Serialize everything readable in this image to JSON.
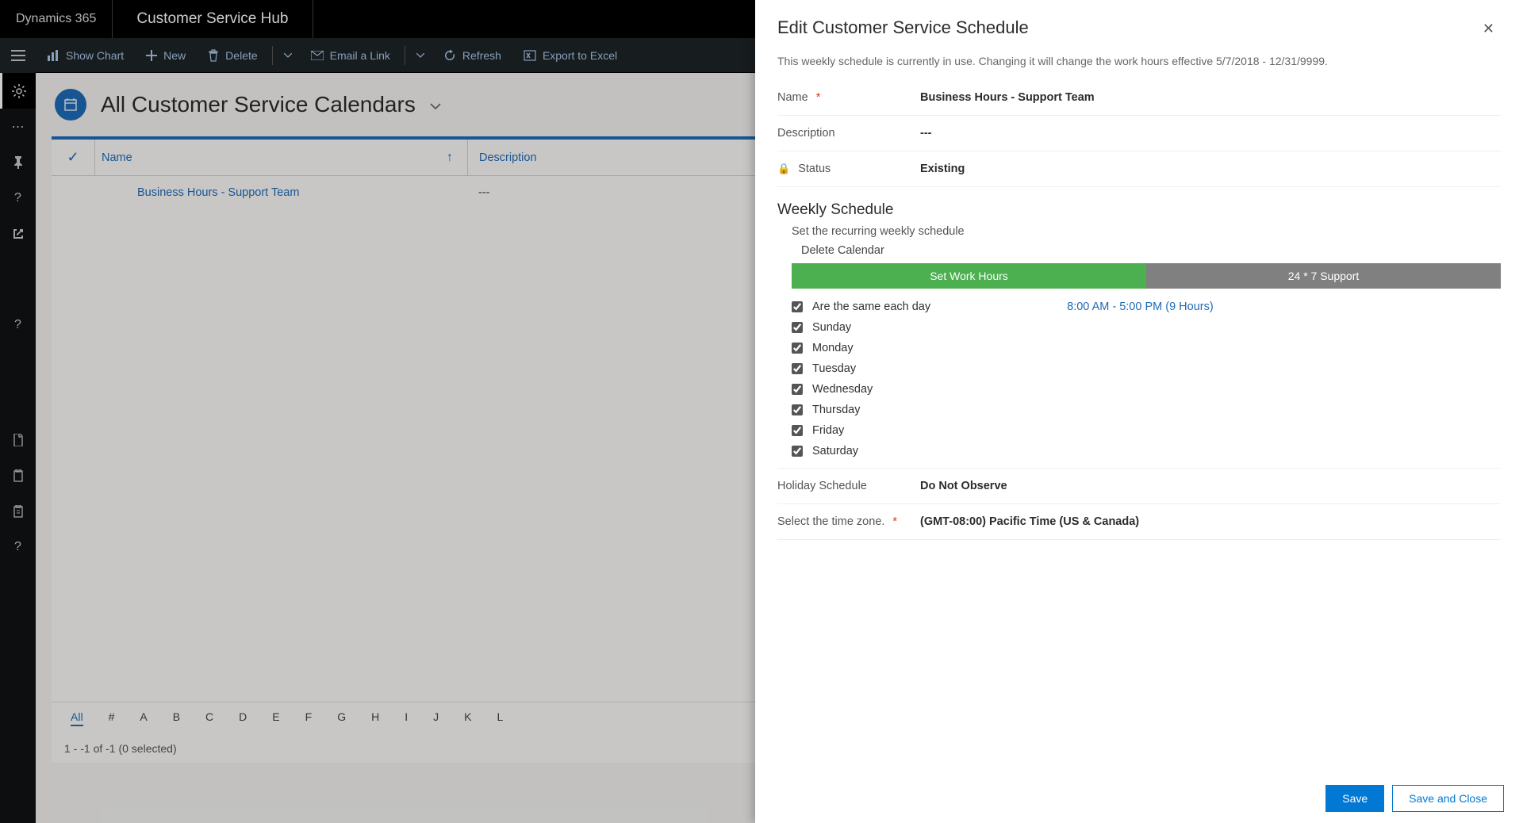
{
  "topnav": {
    "brand": "Dynamics 365",
    "app": "Customer Service Hub"
  },
  "commandbar": {
    "show_chart": "Show Chart",
    "new": "New",
    "delete": "Delete",
    "email_link": "Email a Link",
    "refresh": "Refresh",
    "export": "Export to Excel"
  },
  "view": {
    "title": "All Customer Service Calendars"
  },
  "grid": {
    "col_name": "Name",
    "col_desc": "Description",
    "rows": [
      {
        "name": "Business Hours - Support Team",
        "desc": "---"
      }
    ],
    "alpha": [
      "All",
      "#",
      "A",
      "B",
      "C",
      "D",
      "E",
      "F",
      "G",
      "H",
      "I",
      "J",
      "K",
      "L"
    ],
    "status": "1 - -1 of -1 (0 selected)"
  },
  "panel": {
    "title": "Edit Customer Service Schedule",
    "note": "This weekly schedule is currently in use. Changing it will change the work hours effective 5/7/2018 - 12/31/9999.",
    "fields": {
      "name_label": "Name",
      "name_value": "Business Hours - Support Team",
      "desc_label": "Description",
      "desc_value": "---",
      "status_label": "Status",
      "status_value": "Existing",
      "holiday_label": "Holiday Schedule",
      "holiday_value": "Do Not Observe",
      "tz_label": "Select the time zone.",
      "tz_value": "(GMT-08:00) Pacific Time (US & Canada)"
    },
    "weekly": {
      "heading": "Weekly Schedule",
      "sub": "Set the recurring weekly schedule",
      "delete": "Delete Calendar",
      "tab_work": "Set Work Hours",
      "tab_247": "24 * 7 Support",
      "same_label": "Are the same each day",
      "time_link": "8:00 AM - 5:00 PM (9 Hours)",
      "days": [
        "Sunday",
        "Monday",
        "Tuesday",
        "Wednesday",
        "Thursday",
        "Friday",
        "Saturday"
      ]
    },
    "footer": {
      "save": "Save",
      "save_close": "Save and Close"
    }
  }
}
